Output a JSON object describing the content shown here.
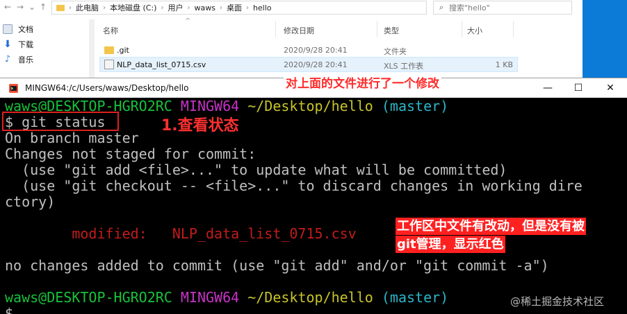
{
  "explorer": {
    "breadcrumbs": [
      "此电脑",
      "本地磁盘 (C:)",
      "用户",
      "waws",
      "桌面",
      "hello"
    ],
    "search_placeholder": "搜索\"hello\"",
    "sidebar": [
      {
        "label": "文档",
        "icon": "documents-icon"
      },
      {
        "label": "下载",
        "icon": "download-icon"
      },
      {
        "label": "音乐",
        "icon": "music-icon"
      }
    ],
    "columns": {
      "name": "名称",
      "date": "修改日期",
      "type": "类型",
      "size": "大小"
    },
    "files": [
      {
        "name": ".git",
        "date": "2020/9/28 20:41",
        "type": "文件夹",
        "size": ""
      },
      {
        "name": "NLP_data_list_0715.csv",
        "date": "2020/9/28 20:41",
        "type": "XLS 工作表",
        "size": "1 KB"
      }
    ]
  },
  "terminal": {
    "title": "MINGW64:/c/Users/waws/Desktop/hello",
    "prompt_user": "waws@DESKTOP-HGRO2RC",
    "prompt_env": "MINGW64",
    "prompt_path": "~/Desktop/hello",
    "prompt_branch": "(master)",
    "prompt_symbol": "$",
    "command": "git status",
    "output": [
      "On branch master",
      "Changes not staged for commit:",
      "  (use \"git add <file>...\" to update what will be committed)",
      "  (use \"git checkout -- <file>...\" to discard changes in working dire",
      "ctory)",
      "",
      "        modified:   NLP_data_list_0715.csv",
      "",
      "no changes added to commit (use \"git add\" and/or \"git commit -a\")"
    ]
  },
  "annotations": {
    "top": "对上面的文件进行了一个修改",
    "step": "1.查看状态",
    "side_line1": "工作区中文件有改动，但是没有被",
    "side_line2": "git管理，显示红色"
  },
  "watermark": "@稀土掘金技术社区",
  "colors": {
    "prompt_green": "#17c23a",
    "prompt_magenta": "#c832c8",
    "prompt_yellow": "#c8c42a",
    "branch_cyan": "#2ab6c8",
    "modified_red": "#c31c1c",
    "annotation_red": "#ff2020"
  }
}
